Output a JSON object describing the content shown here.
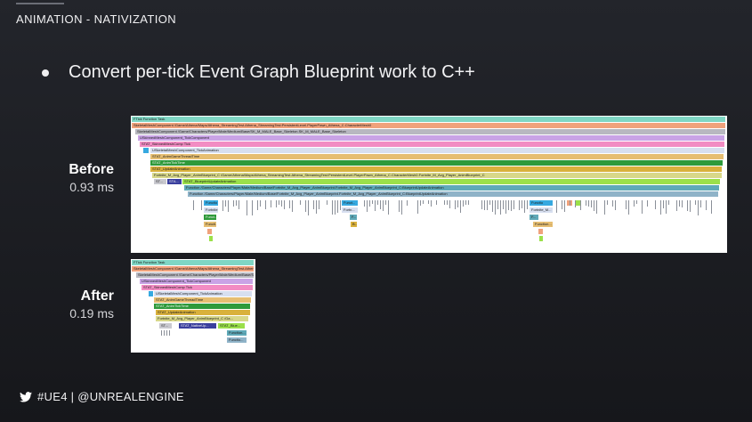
{
  "header": {
    "title": "ANIMATION - NATIVIZATION"
  },
  "bullet": {
    "text": "Convert per-tick Event Graph Blueprint work to C++"
  },
  "before": {
    "label": "Before",
    "time": "0.93 ms"
  },
  "after": {
    "label": "After",
    "time": "0.19 ms"
  },
  "footer": {
    "icon": "twitter-icon",
    "text": "#UE4 | @UNREALENGINE"
  },
  "colors": {
    "white": "#ffffff",
    "gray_tick": "#8a8f98"
  },
  "before_rows": [
    "FTick Function Task",
    "SkeletalMeshComponent /Game/Athena/Maps/Athena_StreamingTest.Athena_StreamingTest:PersistentLevel.PlayerPawn_Athena_C.CharacterMesh0",
    "SkeletalMeshComponent /Game/Characters/Player/Male/Medium/Base/SK_M_MALE_Base_Skeleton.SK_M_MALE_Base_Skeleton",
    "USkinnedMeshComponent_TickComponent",
    "STAT_SkinnedMeshComp Tick",
    "USkeletalMeshComponent_TickAnimation",
    "STAT_AnimGameThreadTime",
    "STAT_AnimTickTime",
    "STAT_UpdateAnimation",
    "Fortnite_M_Avg_Player_AnimBlueprint_C /Game/Athena/Maps/Athena_StreamingTest.Athena_StreamingTest:PersistentLevel.PlayerPawn_Athena_C.CharacterMesh0.Fortnite_M_Avg_Player_AnimBlueprint_C",
    "STAT_BlueprintUpdateAnimation",
    "Function /Game/Characters/Player/Male/Medium/Base/Fortnite_M_Avg_Player_AnimBlueprint.Fortnite_M_Avg_Player_AnimBlueprint_C:BlueprintUpdateAnimation",
    "Function /Game/Characters/Player/Male/Medium/Base/Fortnite_M_Avg_Player_AnimBlueprint.Fortnite_M_Avg_Player_AnimBlueprint_C:BlueprintUpdateAnimation"
  ],
  "before_extras": {
    "st": "ST...",
    "sta": "STA...",
    "functio": "Functio",
    "funct": "Funct...",
    "fortnite": "Fortnite",
    "fortn": "Fortn...",
    "functi": "Functi...",
    "f": "F...",
    "b": "B...",
    "fortnite_m": "Fortnite_M...",
    "function_dots": "Function..."
  },
  "after_rows": [
    "FTick Function Task",
    "SkeletalMeshComponent /Game/Athena/Maps/Athena_StreamingTest.Athena_StreamingTest",
    "SkeletalMeshComponent /Game/Characters/Player/Male/Medium/Base/S...",
    "USkinnedMeshComponent_TickComponent",
    "STAT_SkinnedMeshComp Tick",
    "USkeletalMeshComponent_TickAnimation",
    "STAT_AnimGameThreadTime",
    "STAT_AnimTickTime",
    "STAT_UpdateAnimation",
    "Fortnite_M_Avg_Player_AnimBlueprint_C /Ga...",
    "ST...",
    "STAT_NativeUp...",
    "STAT_Blue...",
    "Function...",
    "Functio..."
  ]
}
